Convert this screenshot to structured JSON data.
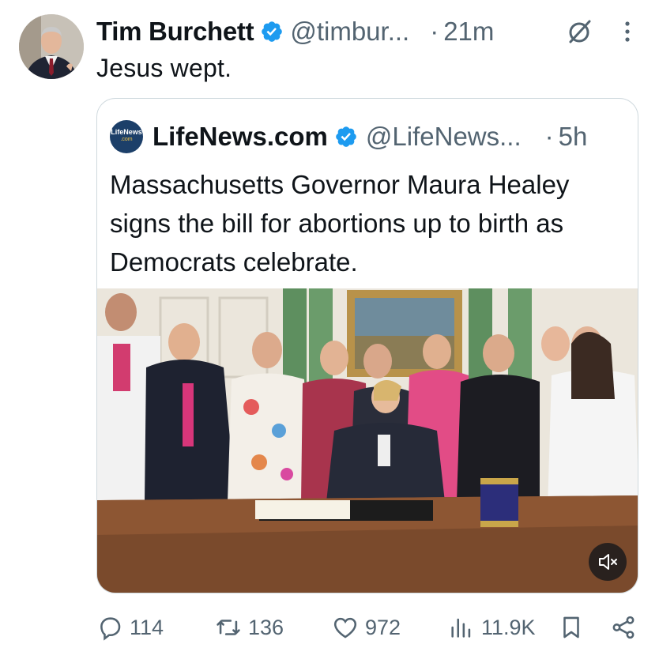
{
  "tweet": {
    "author_name": "Tim Burchett",
    "author_handle": "@timbur...",
    "dot": "·",
    "time": "21m",
    "text": "Jesus wept."
  },
  "quote": {
    "author_name": "LifeNews.com",
    "author_handle": "@LifeNews...",
    "dot": "·",
    "time": "5h",
    "avatar_text": "LifeNews",
    "avatar_sub": ".com",
    "text": "Massachusetts Governor Maura Healey signs the bill for abortions up to birth as Democrats celebrate."
  },
  "actions": {
    "reply_count": "114",
    "retweet_count": "136",
    "like_count": "972",
    "views_count": "11.9K"
  },
  "icons": {
    "verified": "verified-badge-icon",
    "grok": "grok-icon",
    "more": "more-dots-icon",
    "mute": "volume-muted-icon",
    "reply": "reply-icon",
    "retweet": "retweet-icon",
    "like": "heart-icon",
    "views": "views-bar-chart-icon",
    "bookmark": "bookmark-icon",
    "share": "share-icon"
  },
  "colors": {
    "verified": "#1d9bf0",
    "text": "#0f1419",
    "muted": "#536471",
    "border": "#cfd9de"
  }
}
